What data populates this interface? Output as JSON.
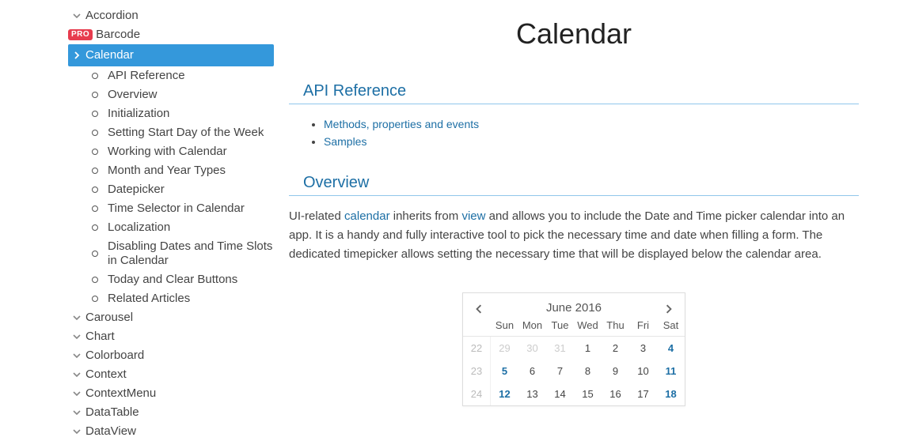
{
  "sidebar": {
    "items": [
      {
        "label": "Accordion"
      },
      {
        "label": "Barcode",
        "pro": "PRO"
      },
      {
        "label": "Calendar",
        "active": true,
        "children": [
          "API Reference",
          "Overview",
          "Initialization",
          "Setting Start Day of the Week",
          "Working with Calendar",
          "Month and Year Types",
          "Datepicker",
          "Time Selector in Calendar",
          "Localization",
          "Disabling Dates and Time Slots in Calendar",
          "Today and Clear Buttons",
          "Related Articles"
        ]
      },
      {
        "label": "Carousel"
      },
      {
        "label": "Chart"
      },
      {
        "label": "Colorboard"
      },
      {
        "label": "Context"
      },
      {
        "label": "ContextMenu"
      },
      {
        "label": "DataTable"
      },
      {
        "label": "DataView"
      }
    ]
  },
  "page": {
    "title": "Calendar",
    "api_heading": "API Reference",
    "api_links": [
      "Methods, properties and events",
      "Samples"
    ],
    "overview_heading": "Overview",
    "overview_text_prefix": "UI-related ",
    "overview_link1": "calendar",
    "overview_text_mid": " inherits from ",
    "overview_link2": "view",
    "overview_text_after": " and allows you to include the Date and Time picker calendar into an app. It is a handy and fully interactive tool to pick the necessary time and date when filling a form. The dedicated timepicker allows setting the necessary time that will be displayed below the calendar area."
  },
  "chart_data": {
    "type": "table",
    "title": "June 2016",
    "weekday_headers": [
      "Sun",
      "Mon",
      "Tue",
      "Wed",
      "Thu",
      "Fri",
      "Sat"
    ],
    "rows": [
      {
        "weeknum": 22,
        "days": [
          29,
          30,
          31,
          1,
          2,
          3,
          4
        ],
        "other_month_until_index": 2
      },
      {
        "weeknum": 23,
        "days": [
          5,
          6,
          7,
          8,
          9,
          10,
          11
        ],
        "other_month_until_index": -1
      },
      {
        "weeknum": 24,
        "days": [
          12,
          13,
          14,
          15,
          16,
          17,
          18
        ],
        "other_month_until_index": -1
      }
    ]
  }
}
